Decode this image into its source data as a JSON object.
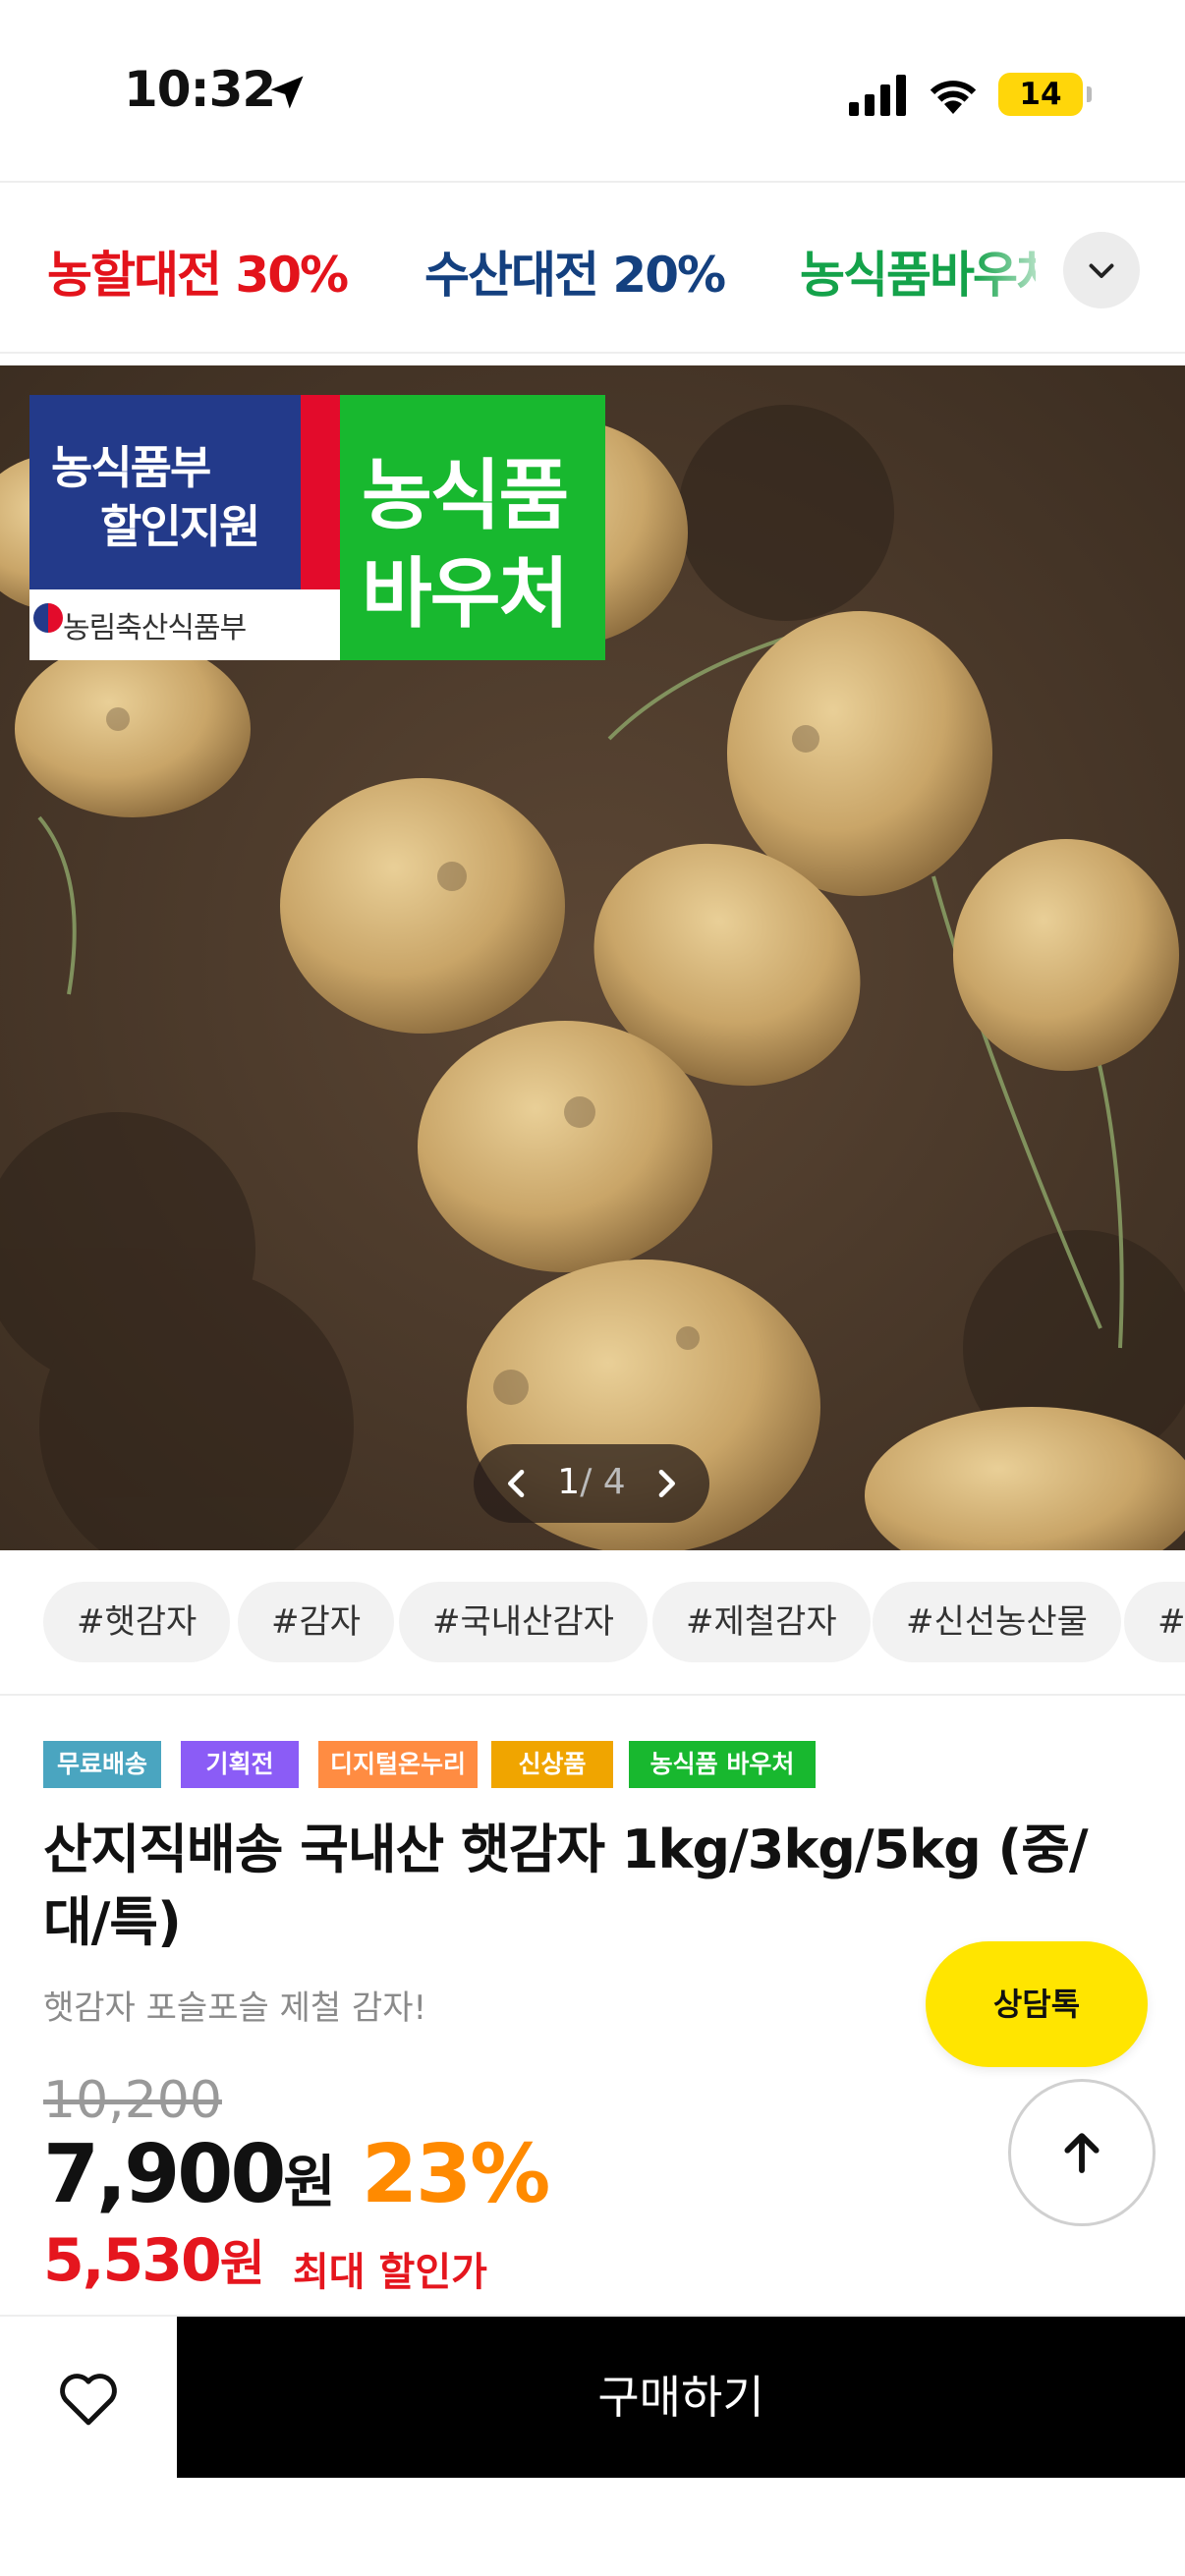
{
  "status_bar": {
    "time": "10:32",
    "battery": "14",
    "icons": [
      "location-arrow-icon",
      "cellular-signal-icon",
      "wifi-icon",
      "battery-charging-icon"
    ]
  },
  "promo_tabs": {
    "items": [
      {
        "label": "농할대전 30%",
        "color": "#e3131b"
      },
      {
        "label": "수산대전 20%",
        "color": "#14407f"
      },
      {
        "label": "농식품바우처",
        "color": "#14a24a"
      }
    ],
    "expand_icon": "chevron-down-icon"
  },
  "product_image": {
    "badge_left_line1": "농식품부",
    "badge_left_line2": "할인지원",
    "badge_left_ministry": "농림축산식품부",
    "badge_right_line1": "농식품",
    "badge_right_line2": "바우처",
    "pager_current": "1",
    "pager_total": "/ 4"
  },
  "tags": [
    "#햇감자",
    "#감자",
    "#국내산감자",
    "#제철감자",
    "#신선농산물",
    "#국내산"
  ],
  "labels": [
    {
      "text": "무료배송",
      "color": "#4aa5c0"
    },
    {
      "text": "기획전",
      "color": "#8b5cf6"
    },
    {
      "text": "디지털온누리",
      "color": "#ff8c42"
    },
    {
      "text": "신상품",
      "color": "#f0a500"
    },
    {
      "text": "농식품 바우처",
      "color": "#18b82f"
    }
  ],
  "product": {
    "title": "산지직배송 국내산 햇감자 1kg/3kg/5kg (중/대/특)",
    "subtitle": "햇감자 포슬포슬 제철 감자!",
    "original_price": "10,200",
    "price": "7,900",
    "price_unit": "원",
    "discount": "23%",
    "max_discount_price": "5,530",
    "max_discount_unit": "원",
    "max_discount_label": "최대 할인가"
  },
  "floating": {
    "chat_label": "상담톡",
    "top_icon": "arrow-up-icon"
  },
  "bottom_bar": {
    "wish_icon": "heart-icon",
    "buy_label": "구매하기"
  }
}
